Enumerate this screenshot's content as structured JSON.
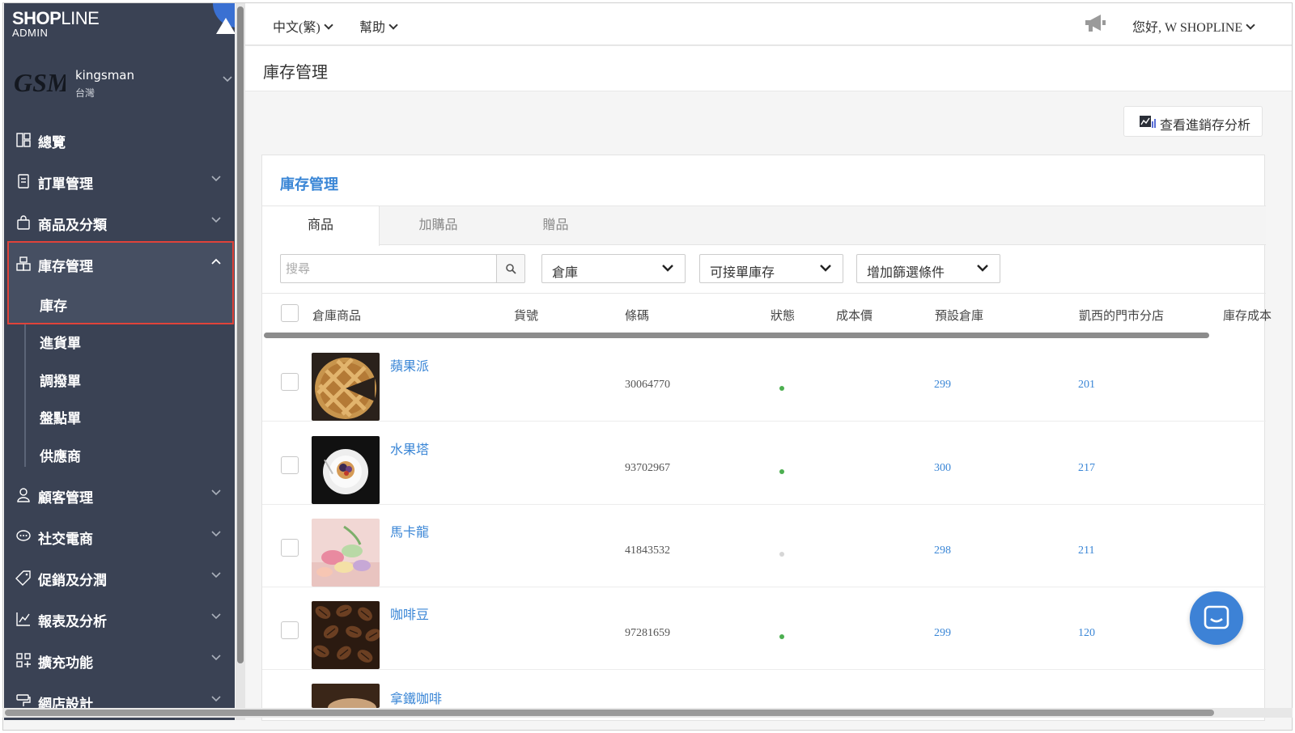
{
  "brand": {
    "logo_bold": "SHOP",
    "logo_thin": "LINE",
    "logo_sub": "ADMIN"
  },
  "store": {
    "logo_text": "GSM",
    "name": "kingsman",
    "region": "台灣"
  },
  "sidebar": {
    "items": [
      {
        "label": "總覽",
        "icon": "dashboard-icon"
      },
      {
        "label": "訂單管理",
        "icon": "order-icon"
      },
      {
        "label": "商品及分類",
        "icon": "shopping-bag-icon"
      },
      {
        "label": "庫存管理",
        "icon": "inventory-icon"
      },
      {
        "label": "顧客管理",
        "icon": "user-icon"
      },
      {
        "label": "社交電商",
        "icon": "chat-bubble-icon"
      },
      {
        "label": "促銷及分潤",
        "icon": "tag-icon"
      },
      {
        "label": "報表及分析",
        "icon": "chart-icon"
      },
      {
        "label": "擴充功能",
        "icon": "apps-icon"
      },
      {
        "label": "網店設計",
        "icon": "paint-roller-icon"
      }
    ],
    "sub_items": [
      "庫存",
      "進貨單",
      "調撥單",
      "盤點單",
      "供應商"
    ]
  },
  "topbar": {
    "language": "中文(繁)",
    "help": "幫助",
    "greeting": "您好, W SHOPLINE"
  },
  "page": {
    "title": "庫存管理",
    "analysis_button": "查看進銷存分析"
  },
  "card": {
    "title": "庫存管理",
    "tabs": [
      "商品",
      "加購品",
      "贈品"
    ],
    "search_placeholder": "搜尋",
    "filters": [
      "倉庫",
      "可接單庫存",
      "增加篩選條件"
    ]
  },
  "table": {
    "headers": [
      "倉庫商品",
      "貨號",
      "條碼",
      "狀態",
      "成本價",
      "預設倉庫",
      "凱西的門市分店",
      "庫存成本"
    ],
    "rows": [
      {
        "name": "蘋果派",
        "sku": "",
        "barcode": "30064770",
        "status": "active",
        "default_stock": "299",
        "store_stock": "201"
      },
      {
        "name": "水果塔",
        "sku": "",
        "barcode": "93702967",
        "status": "active",
        "default_stock": "300",
        "store_stock": "217"
      },
      {
        "name": "馬卡龍",
        "sku": "",
        "barcode": "41843532",
        "status": "inactive",
        "default_stock": "298",
        "store_stock": "211"
      },
      {
        "name": "咖啡豆",
        "sku": "",
        "barcode": "97281659",
        "status": "active",
        "default_stock": "299",
        "store_stock": "120"
      },
      {
        "name": "拿鐵咖啡",
        "sku": "",
        "barcode": "",
        "status": "",
        "default_stock": "",
        "store_stock": ""
      }
    ]
  },
  "colors": {
    "sidebar_bg": "#3a4254",
    "accent_blue": "#3a86d6",
    "highlight_red": "#e0433a",
    "status_active": "#4caf50",
    "status_inactive": "#d6d6d6"
  }
}
